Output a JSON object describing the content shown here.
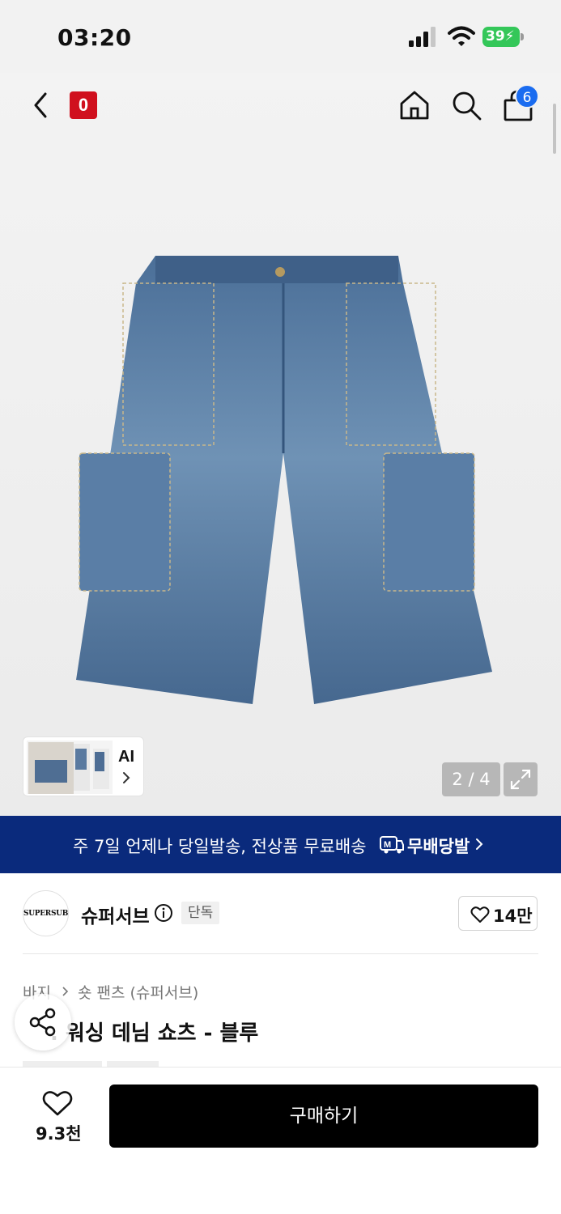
{
  "status_bar": {
    "time": "03:20",
    "battery": "39",
    "icons": [
      "cellular-signal-icon",
      "wifi-icon",
      "battery-charging-icon"
    ]
  },
  "header": {
    "brand_mark": "0",
    "cart_count": "6",
    "icons": [
      "back-icon",
      "home-icon",
      "search-icon",
      "shopping-bag-icon"
    ],
    "brand_mark_color": "#d0101e",
    "badge_color": "#1a6cf0"
  },
  "gallery": {
    "ai_label": "AI",
    "pager": "2 / 4",
    "icons": [
      "chevron-right-icon",
      "expand-icon"
    ]
  },
  "banner": {
    "text": "주 7일 언제나 당일발송, 전상품 무료배송",
    "logo_text": "무배당발",
    "color": "#0a2a7c"
  },
  "brand": {
    "logo_text": "SUPERSUB",
    "name": "슈퍼서브",
    "badge": "단독",
    "like_count": "14만"
  },
  "product": {
    "breadcrumb": [
      "바지",
      "숏 팬츠 (슈퍼서브)"
    ],
    "title_visible": ". 워싱 데님 쇼츠 - 블루"
  },
  "bottom_bar": {
    "wish_count": "9.3천",
    "buy_label": "구매하기"
  }
}
